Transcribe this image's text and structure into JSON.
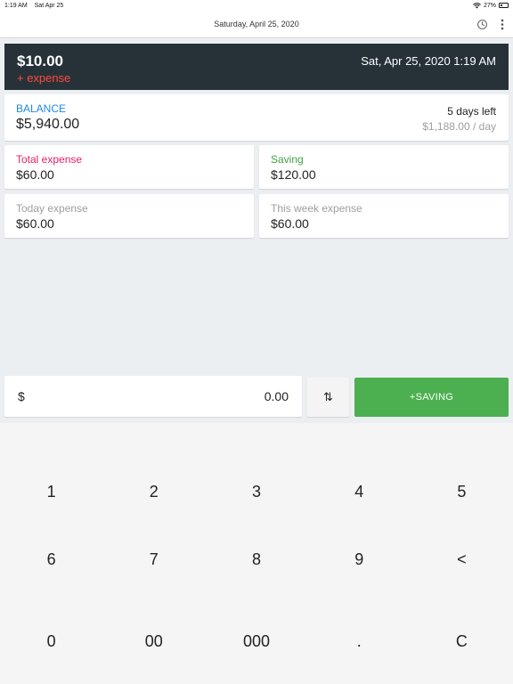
{
  "status": {
    "time": "1:19 AM",
    "date": "Sat Apr 25",
    "battery": "27%"
  },
  "app_bar": {
    "title": "Saturday, April 25, 2020"
  },
  "header": {
    "amount": "$10.00",
    "kind": "+ expense",
    "datetime": "Sat, Apr 25, 2020 1:19 AM"
  },
  "balance": {
    "label": "BALANCE",
    "value": "$5,940.00",
    "days_left": "5 days left",
    "per_day_amount": "$1,188.00",
    "per_day_unit": " / day"
  },
  "stats": [
    {
      "label": "Total expense",
      "value": "$60.00"
    },
    {
      "label": "Saving",
      "value": "$120.00"
    },
    {
      "label": "Today expense",
      "value": "$60.00"
    },
    {
      "label": "This week expense",
      "value": "$60.00"
    }
  ],
  "input": {
    "currency": "$",
    "value": "0.00",
    "toggle_glyph": "⇅",
    "action_label": "+SAVING"
  },
  "keypad": {
    "keys": [
      "1",
      "2",
      "3",
      "4",
      "5",
      "6",
      "7",
      "8",
      "9",
      "<",
      "0",
      "00",
      "000",
      ".",
      "C"
    ]
  },
  "icons": {
    "wifi": "wifi-icon",
    "battery": "battery-icon",
    "history": "history-icon",
    "more": "more-vert-icon",
    "swap": "swap-vert-icon"
  },
  "colors": {
    "header_bg": "#263238",
    "expense_red": "#ff4a3d",
    "balance_blue": "#1e88e5",
    "total_pink": "#e91e63",
    "saving_green": "#43a047",
    "action_green": "#4caf50"
  }
}
